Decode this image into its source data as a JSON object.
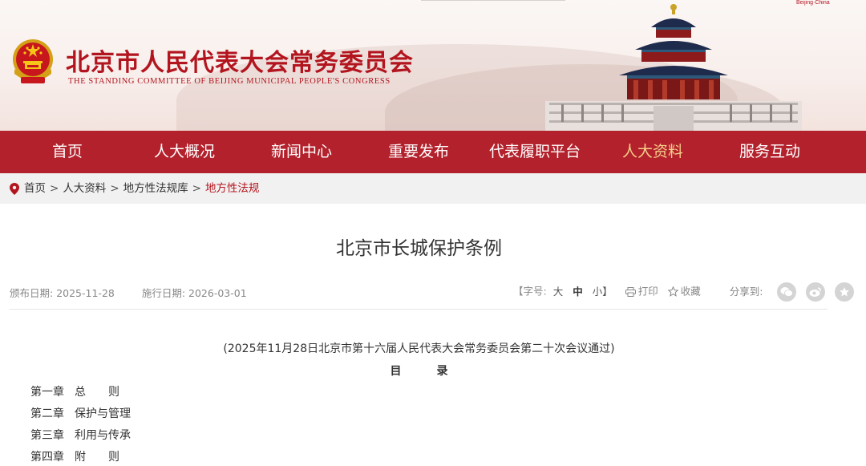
{
  "header": {
    "title": "北京市人民代表大会常务委员会",
    "subtitle": "THE STANDING COMMITTEE OF BEIJING MUNICIPAL PEOPLE'S CONGRESS",
    "corner_logo": "Beijing·China",
    "emblem_icon": "national-emblem-icon"
  },
  "nav": {
    "items": [
      {
        "label": "首页"
      },
      {
        "label": "人大概况"
      },
      {
        "label": "新闻中心"
      },
      {
        "label": "重要发布"
      },
      {
        "label": "代表履职平台"
      },
      {
        "label": "人大资料",
        "active": true
      },
      {
        "label": "服务互动"
      }
    ],
    "active_color": "#f5cf8a",
    "bar_color": "#b3212c"
  },
  "breadcrumb": {
    "icon": "location-pin-icon",
    "items": [
      "首页",
      "人大资料",
      "地方性法规库"
    ],
    "current": "地方性法规",
    "separator": ">"
  },
  "article": {
    "title": "北京市长城保护条例",
    "publish_label": "颁布日期:",
    "publish_date": "2025-11-28",
    "effective_label": "施行日期:",
    "effective_date": "2026-03-01",
    "font_label": "【字号:",
    "font_large": "大",
    "font_medium": "中",
    "font_small": "小】",
    "print_label": "打印",
    "favorite_label": "收藏",
    "share_label": "分享到:",
    "passage": "(2025年11月28日北京市第十六届人民代表大会常务委员会第二十次会议通过)",
    "toc_heading": "目录",
    "toc": [
      {
        "chapter": "第一章",
        "name": "总　　则"
      },
      {
        "chapter": "第二章",
        "name": "保护与管理"
      },
      {
        "chapter": "第三章",
        "name": "利用与传承"
      },
      {
        "chapter": "第四章",
        "name": "附　　则"
      }
    ]
  }
}
